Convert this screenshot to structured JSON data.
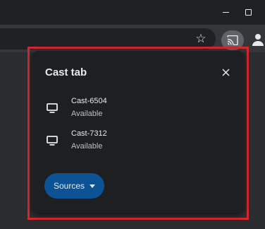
{
  "window": {
    "minimize_icon": "minimize-icon",
    "maximize_icon": "maximize-icon"
  },
  "toolbar": {
    "bookmark_icon": "star-icon",
    "cast_icon": "cast-icon",
    "profile_icon": "profile-icon"
  },
  "cast_dialog": {
    "title": "Cast tab",
    "close_icon": "close-icon",
    "sinks": [
      {
        "name": "Cast-6504",
        "status": "Available",
        "icon": "monitor-icon"
      },
      {
        "name": "Cast-7312",
        "status": "Available",
        "icon": "monitor-icon"
      }
    ],
    "sources_button": {
      "label": "Sources",
      "icon": "caret-down-icon"
    }
  },
  "colors": {
    "dialog_background": "#1e1f20",
    "sources_button": "#0b5394",
    "highlight_border": "#d6262e",
    "text_primary": "#e8eaed"
  }
}
